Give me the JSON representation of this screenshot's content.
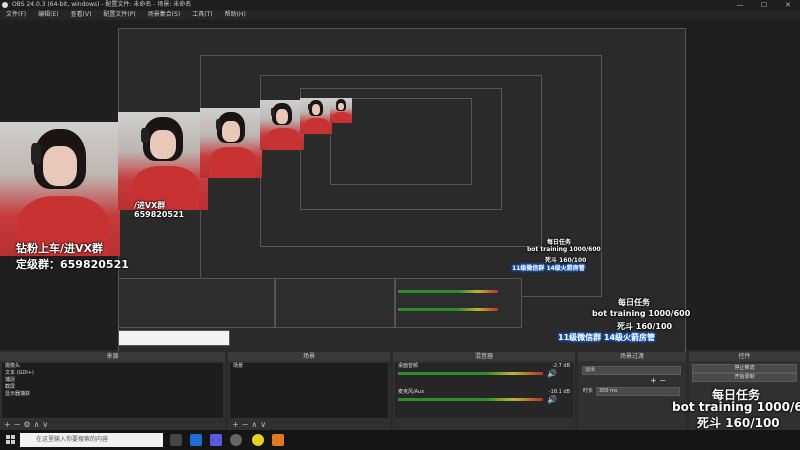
{
  "window": {
    "title": "OBS 24.0.3 (64-bit, windows) - 配置文件: 未命名 - 场景: 未命名",
    "buttons": [
      "—",
      "☐",
      "✕"
    ]
  },
  "menu": [
    "文件(F)",
    "编辑(E)",
    "查看(V)",
    "配置文件(P)",
    "场景集合(S)",
    "工具(T)",
    "帮助(H)"
  ],
  "overlay": {
    "line1": "钻粉上车/进VX群",
    "line2": "定级群：659820521",
    "tier2_line1": "/进VX群",
    "tier2_line2": "659820521",
    "task_title": "每日任务",
    "task_line1": "bot training 1000/600",
    "task_line2": "死斗 160/100",
    "banner": "11级微信群 14级火箭房管"
  },
  "docks": {
    "sources": {
      "header": "来源",
      "items": [
        "摄像头",
        "文本 (GDI+)",
        "捕捉",
        "截屏",
        "显示器捕获"
      ]
    },
    "scenes": {
      "header": "场景",
      "items": [
        "场景"
      ]
    },
    "mixer": {
      "header": "混音器",
      "tracks": [
        {
          "name": "桌面音频",
          "db": "-2.7 dB"
        },
        {
          "name": "麦克风/Aux",
          "db": "-18.1 dB"
        }
      ]
    },
    "transitions": {
      "header": "场景过渡",
      "selected": "淡出",
      "duration_label": "时长",
      "duration_value": "300 ms"
    },
    "controls": {
      "header": "控件",
      "buttons": [
        "停止推流",
        "开始录制"
      ]
    }
  },
  "status": {
    "text": "LIVE: 00:00:00  REC: 00:00:00  CPU: 1.2%, 30.00 fps"
  },
  "taskbar": {
    "search_placeholder": "在这里输入你要搜索的内容",
    "clock": "2020"
  },
  "colors": {
    "accent": "#3a3a3a",
    "red_shirt": "#c83232",
    "meter_green": "#2e8b2e",
    "meter_yellow": "#b8b82e",
    "meter_red": "#b83030"
  }
}
